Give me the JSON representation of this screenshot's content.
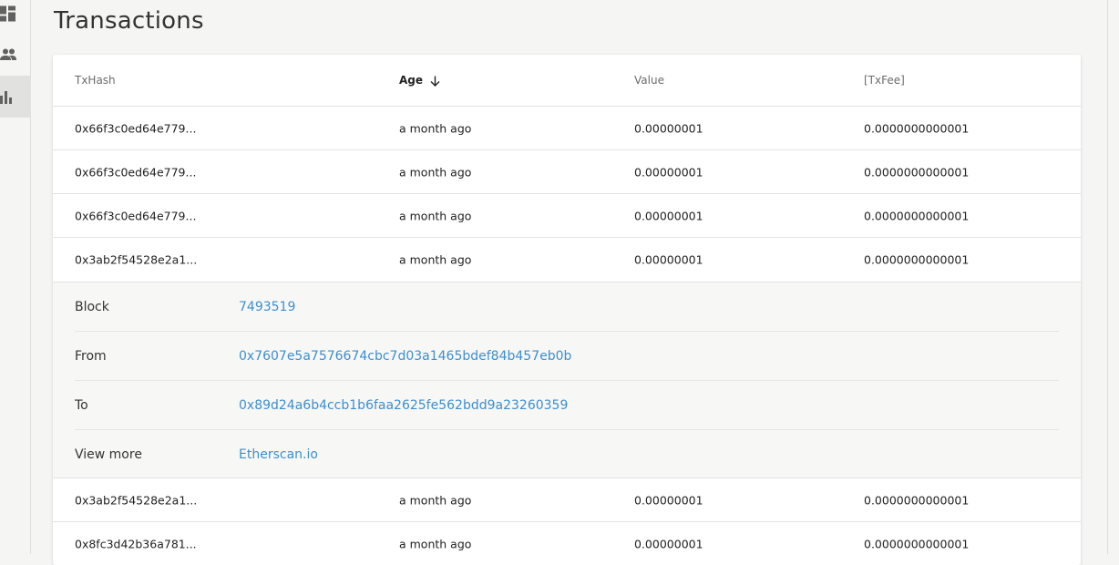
{
  "sidebar": {
    "items": [
      {
        "icon": "dashboard-icon"
      },
      {
        "icon": "people-icon"
      },
      {
        "icon": "bar-chart-icon"
      }
    ]
  },
  "page": {
    "title": "Transactions"
  },
  "table": {
    "columns": {
      "txhash": "TxHash",
      "age": "Age",
      "value": "Value",
      "txfee": "[TxFee]"
    },
    "rows": [
      {
        "hash": "0x66f3c0ed64e779...",
        "age": "a month ago",
        "value": "0.00000001",
        "fee": "0.0000000000001"
      },
      {
        "hash": "0x66f3c0ed64e779...",
        "age": "a month ago",
        "value": "0.00000001",
        "fee": "0.0000000000001"
      },
      {
        "hash": "0x66f3c0ed64e779...",
        "age": "a month ago",
        "value": "0.00000001",
        "fee": "0.0000000000001"
      },
      {
        "hash": "0x3ab2f54528e2a1...",
        "age": "a month ago",
        "value": "0.00000001",
        "fee": "0.0000000000001"
      },
      {
        "hash": "0x3ab2f54528e2a1...",
        "age": "a month ago",
        "value": "0.00000001",
        "fee": "0.0000000000001"
      },
      {
        "hash": "0x8fc3d42b36a781...",
        "age": "a month ago",
        "value": "0.00000001",
        "fee": "0.0000000000001"
      }
    ],
    "details": {
      "block_label": "Block",
      "block_value": "7493519",
      "from_label": "From",
      "from_value": "0x7607e5a7576674cbc7d03a1465bdef84b457eb0b",
      "to_label": "To",
      "to_value": "0x89d24a6b4ccb1b6faa2625fe562bdd9a23260359",
      "more_label": "View more",
      "more_value": "Etherscan.io"
    }
  },
  "colors": {
    "link": "#3d8fd1",
    "active_nav": "#e1e1e0",
    "background": "#f5f5f4"
  }
}
